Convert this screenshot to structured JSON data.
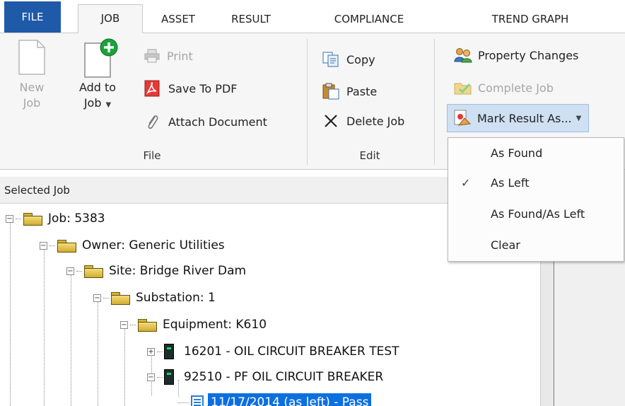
{
  "tabs": [
    "FILE",
    "JOB",
    "ASSET",
    "RESULT",
    "COMPLIANCE",
    "TREND GRAPH"
  ],
  "ribbon": {
    "file_group": {
      "new_job": [
        "New",
        "Job"
      ],
      "add_to_job": [
        "Add to",
        "Job"
      ],
      "print": "Print",
      "save_pdf": "Save To PDF",
      "attach": "Attach Document",
      "label": "File"
    },
    "edit_group": {
      "copy": "Copy",
      "paste": "Paste",
      "delete": "Delete Job",
      "label": "Edit"
    },
    "result_group": {
      "property_changes": "Property Changes",
      "complete_job": "Complete Job",
      "mark_result": "Mark Result As..."
    }
  },
  "dropdown": {
    "items": [
      "As Found",
      "As Left",
      "As Found/As Left",
      "Clear"
    ],
    "checked": "As Left"
  },
  "panel": {
    "title": "Selected Job"
  },
  "tree": {
    "job": "Job: 5383",
    "owner": "Owner: Generic Utilities",
    "site": "Site: Bridge River Dam",
    "substation": "Substation: 1",
    "equipment": "Equipment: K610",
    "asset1": "16201 - OIL CIRCUIT BREAKER TEST",
    "asset2": "92510 - PF OIL CIRCUIT BREAKER",
    "result": "11/17/2014 (as left) - Pass"
  },
  "colors": {
    "file_tab": "#1e5aa8",
    "selection": "#0c6fe0",
    "mark_button": "#cfe0f3"
  }
}
